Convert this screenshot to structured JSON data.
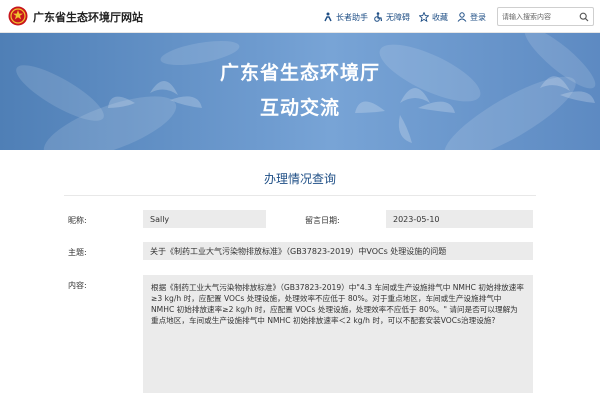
{
  "header": {
    "site_name": "广东省生态环境厅网站",
    "toolbar": [
      {
        "label": "长者助手",
        "icon": "elder-assist-icon"
      },
      {
        "label": "无障碍",
        "icon": "accessibility-icon"
      },
      {
        "label": "收藏",
        "icon": "star-icon"
      },
      {
        "label": "登录",
        "icon": "user-icon"
      }
    ],
    "search_placeholder": "请输入搜索内容"
  },
  "banner": {
    "title": "广东省生态环境厅",
    "subtitle": "互动交流"
  },
  "main": {
    "section_title": "办理情况查询",
    "fields": {
      "nickname_label": "昵称:",
      "nickname_value": "Sally",
      "date_label": "留言日期:",
      "date_value": "2023-05-10",
      "subject_label": "主题:",
      "subject_value": "关于《制药工业大气污染物排放标准》（GB37823-2019）中VOCs 处理设施的问题",
      "content_label": "内容:",
      "content_value": "根据《制药工业大气污染物排放标准》（GB37823-2019）中\"4.3 车间或生产设施排气中 NMHC 初始排放速率≥3 kg/h 时，应配置 VOCs 处理设施，处理效率不应低于 80%。对于重点地区，车间或生产设施排气中 NMHC 初始排放速率≥2 kg/h 时，应配置 VOCs 处理设施，处理效率不应低于 80%。\" 请问是否可以理解为重点地区，车间或生产设施排气中 NMHC 初始排放速率＜2 kg/h 时，可以不配套安装VOCs治理设施?"
    }
  },
  "colors": {
    "accent": "#1f4f86",
    "banner": "#6f9cd0",
    "field_bg": "#ebebeb"
  }
}
